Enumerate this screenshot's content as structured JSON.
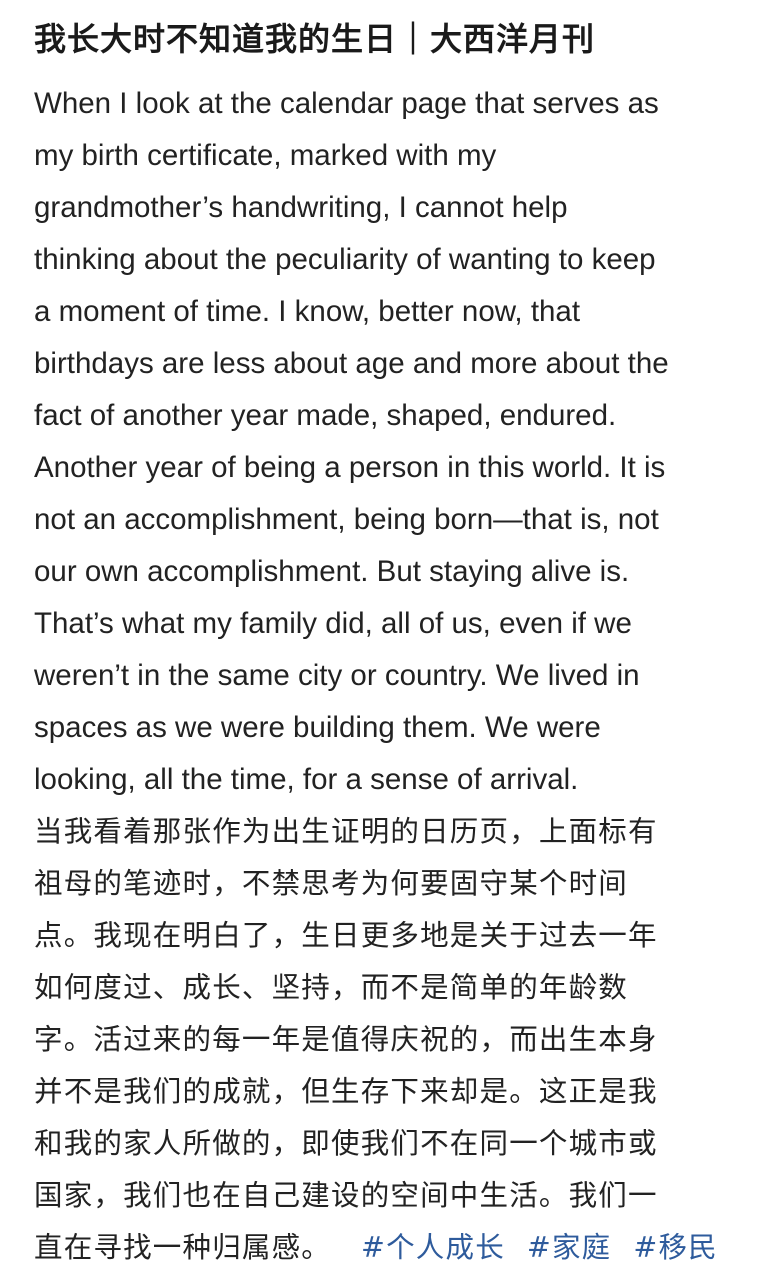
{
  "post": {
    "title": "我长大时不知道我的生日｜大西洋月刊",
    "english_lines": [
      "When I look at the calendar page that serves as",
      "my birth certificate, marked with my",
      "grandmother’s handwriting, I cannot help",
      "thinking about the peculiarity of wanting to keep",
      "a moment of time. I know, better now, that",
      "birthdays are less about age and more about the",
      "fact of another year made, shaped, endured.",
      "Another year of being a person in this world. It is",
      "not an accomplishment, being born—that is, not",
      "our own accomplishment. But staying alive is.",
      "That’s what my family did, all of us, even if we",
      "weren’t in the same city or country. We lived in",
      "spaces as we were building them. We were",
      "looking, all the time, for a sense of arrival."
    ],
    "chinese_lines": [
      "当我看着那张作为出生证明的日历页，上面标有",
      "祖母的笔迹时，不禁思考为何要固守某个时间",
      "点。我现在明白了，生日更多地是关于过去一年",
      "如何度过、成长、坚持，而不是简单的年龄数",
      "字。活过来的每一年是值得庆祝的，而出生本身",
      "并不是我们的成就，但生存下来却是。这正是我",
      "和我的家人所做的，即使我们不在同一个城市或",
      "国家，我们也在自己建设的空间中生活。我们一",
      "直在寻找一种归属感。"
    ],
    "hashtags": [
      "#个人成长",
      "#家庭",
      "#移民"
    ]
  },
  "colors": {
    "text": "#222222",
    "hashtag": "#2e5b9c",
    "background": "#ffffff"
  }
}
